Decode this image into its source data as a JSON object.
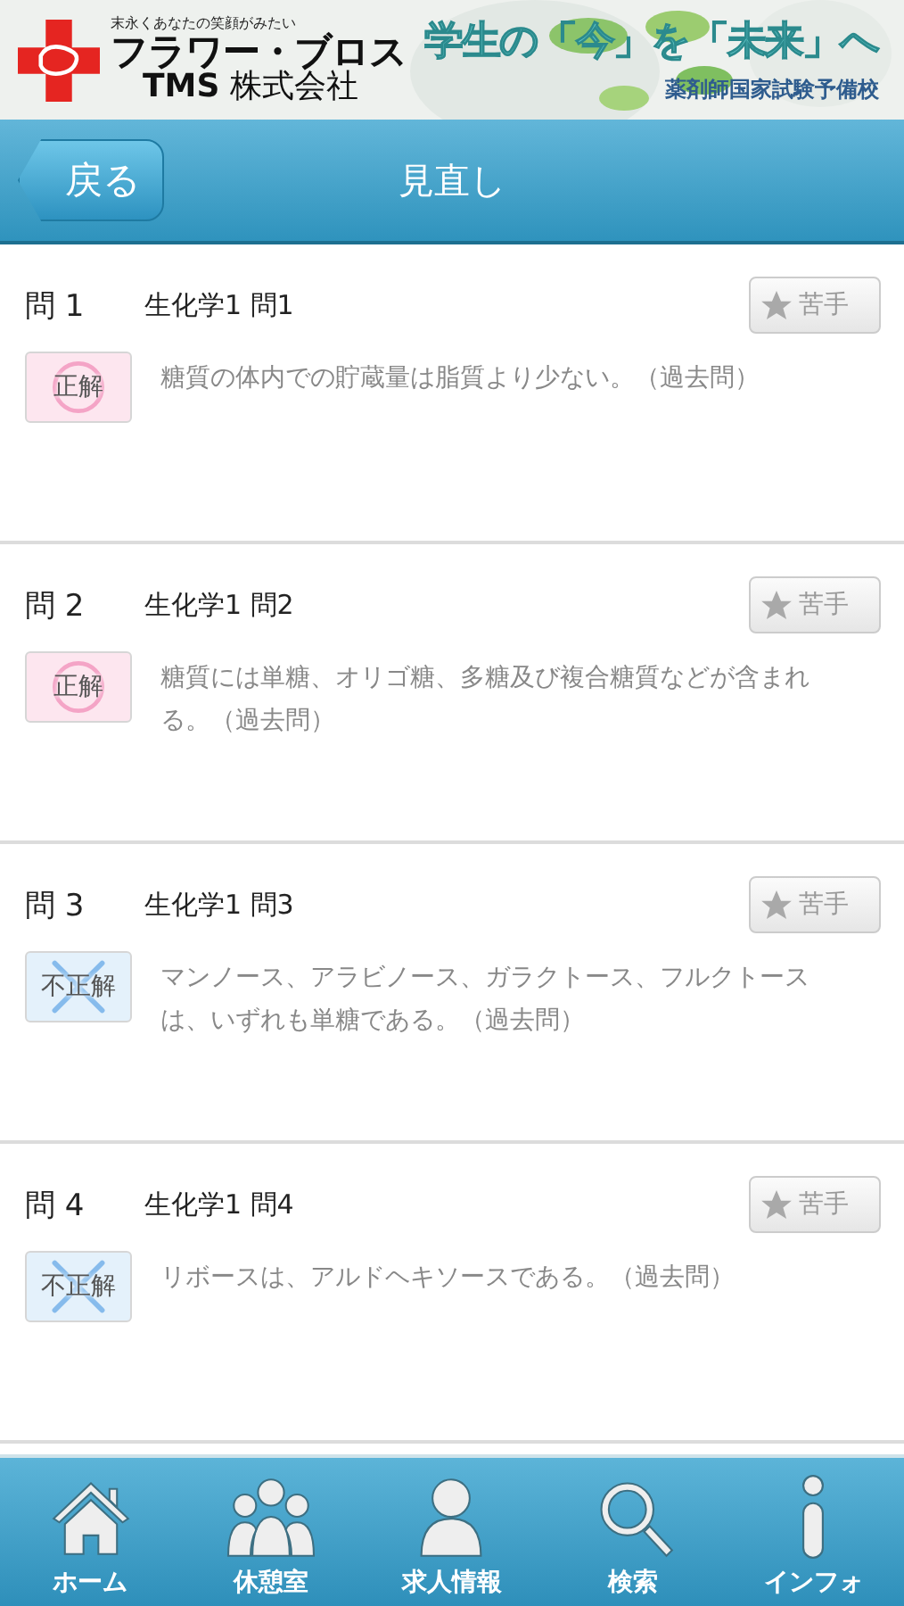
{
  "banner": {
    "tagline": "末永くあなたの笑顔がみたい",
    "company_line1": "フラワー・ブロス",
    "company_brand": "TMS",
    "company_line2": "株式会社",
    "headline": "学生の「今」を「未来」へ",
    "subline": "薬剤師国家試験予備校"
  },
  "nav": {
    "back": "戻る",
    "title": "見直し"
  },
  "questions": [
    {
      "number": "問 1",
      "category": "生化学1 問1",
      "result": {
        "kind": "correct",
        "label": "正解"
      },
      "text": "糖質の体内での貯蔵量は脂質より少ない。（過去問）",
      "weak_button": "苦手"
    },
    {
      "number": "問 2",
      "category": "生化学1 問2",
      "result": {
        "kind": "correct",
        "label": "正解"
      },
      "text": "糖質には単糖、オリゴ糖、多糖及び複合糖質などが含まれる。（過去問）",
      "weak_button": "苦手"
    },
    {
      "number": "問 3",
      "category": "生化学1 問3",
      "result": {
        "kind": "incorrect",
        "label": "不正解"
      },
      "text": "マンノース、アラビノース、ガラクトース、フルクトースは、いずれも単糖である。（過去問）",
      "weak_button": "苦手"
    },
    {
      "number": "問 4",
      "category": "生化学1 問4",
      "result": {
        "kind": "incorrect",
        "label": "不正解"
      },
      "text": "リボースは、アルドヘキソースである。（過去問）",
      "weak_button": "苦手"
    }
  ],
  "tabbar": [
    {
      "kind": "home",
      "label": "ホーム"
    },
    {
      "kind": "group",
      "label": "休憩室"
    },
    {
      "kind": "person",
      "label": "求人情報"
    },
    {
      "kind": "search",
      "label": "検索"
    },
    {
      "kind": "info",
      "label": "インフォ"
    }
  ]
}
